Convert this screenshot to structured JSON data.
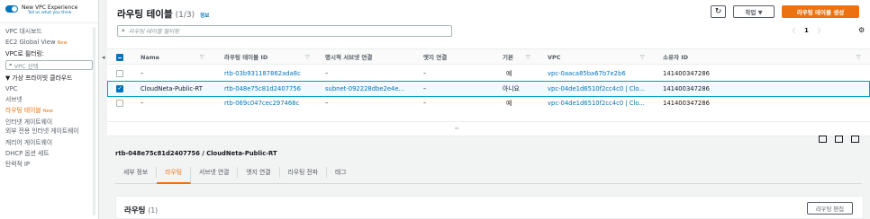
{
  "sidebar": {
    "new_vpc_title": "New VPC Experience",
    "new_vpc_sub": "Tell us what you think",
    "dashboard": "VPC 대시보드",
    "global_view": "EC2 Global View",
    "global_view_badge": "New",
    "filter_label": "VPC로 필터링:",
    "filter_placeholder": "VPC 선택",
    "group_title": "▼ 가상 프라이빗 클라우드",
    "items": [
      "VPC",
      "서브넷",
      "라우팅 테이블",
      "인터넷 게이트웨이",
      "외부 전용 인터넷 게이트웨이",
      "캐리어 게이트웨이",
      "DHCP 옵션 세트",
      "탄력적 IP"
    ],
    "active_badge": "New"
  },
  "header": {
    "title": "라우팅 테이블",
    "count": "(1/3)",
    "info": "정보",
    "action_label": "작업 ▼",
    "create_label": "라우팅 테이블 생성"
  },
  "search": {
    "placeholder": "라우팅 테이블 필터링"
  },
  "pager": {
    "prev": "〈",
    "page": "1",
    "next": "〉"
  },
  "table": {
    "columns": [
      "Name",
      "라우팅 테이블 ID",
      "명시적 서브넷 연결",
      "엣지 연결",
      "기본",
      "VPC",
      "소유자 ID"
    ],
    "rows": [
      {
        "name": "–",
        "id": "rtb-03b931187862ada8c",
        "subnet": "–",
        "edge": "–",
        "main": "예",
        "vpc": "vpc-0aaca85ba67b7e2b6",
        "owner": "141400347286",
        "selected": false
      },
      {
        "name": "CloudNeta-Public-RT",
        "id": "rtb-048e75c81d2407756",
        "subnet": "subnet-092228dbe2e4e...",
        "edge": "–",
        "main": "아니요",
        "vpc": "vpc-04de1d6510f2cc4c0 | Clo...",
        "owner": "141400347286",
        "selected": true
      },
      {
        "name": "–",
        "id": "rtb-069c047cec297468c",
        "subnet": "–",
        "edge": "–",
        "main": "예",
        "vpc": "vpc-04de1d6510f2cc4c0 | Clo...",
        "owner": "141400347286",
        "selected": false
      }
    ]
  },
  "detail": {
    "title": "rtb-048e75c81d2407756 / CloudNeta-Public-RT",
    "tabs": [
      "세부 정보",
      "라우팅",
      "서브넷 연결",
      "엣지 연결",
      "라우팅 전파",
      "태그"
    ],
    "active_tab": 1,
    "routes_title": "라우팅",
    "routes_count": "(1)",
    "edit_label": "라우팅 편집"
  },
  "colors": {
    "accent": "#ec7211",
    "link": "#0073bb",
    "selected_border": "#00a1c9"
  }
}
